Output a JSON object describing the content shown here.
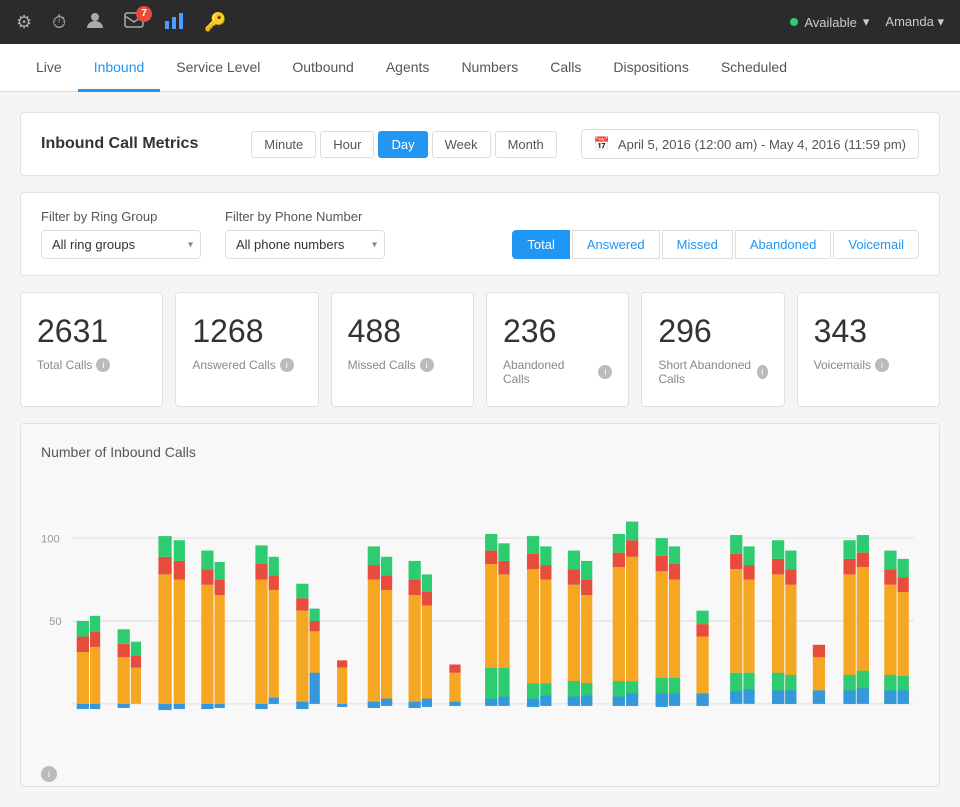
{
  "topNav": {
    "icons": [
      {
        "name": "recycle-icon",
        "symbol": "♻",
        "active": false
      },
      {
        "name": "clock-icon",
        "symbol": "⏱",
        "active": false
      },
      {
        "name": "person-icon",
        "symbol": "👤",
        "active": false
      },
      {
        "name": "mail-icon",
        "symbol": "✉",
        "active": false,
        "badge": "7"
      },
      {
        "name": "chart-icon",
        "symbol": "📊",
        "active": true
      },
      {
        "name": "key-icon",
        "symbol": "🔑",
        "active": false
      }
    ],
    "status": "Available",
    "user": "Amanda"
  },
  "tabs": [
    {
      "label": "Live",
      "active": false
    },
    {
      "label": "Inbound",
      "active": true
    },
    {
      "label": "Service Level",
      "active": false
    },
    {
      "label": "Outbound",
      "active": false
    },
    {
      "label": "Agents",
      "active": false
    },
    {
      "label": "Numbers",
      "active": false
    },
    {
      "label": "Calls",
      "active": false
    },
    {
      "label": "Dispositions",
      "active": false
    },
    {
      "label": "Scheduled",
      "active": false
    }
  ],
  "metrics": {
    "title": "Inbound Call Metrics",
    "timeButtons": [
      {
        "label": "Minute",
        "active": false
      },
      {
        "label": "Hour",
        "active": false
      },
      {
        "label": "Day",
        "active": true
      },
      {
        "label": "Week",
        "active": false
      },
      {
        "label": "Month",
        "active": false
      }
    ],
    "dateRange": "April 5, 2016 (12:00 am) - May 4, 2016 (11:59 pm)"
  },
  "filters": {
    "ringGroupLabel": "Filter by Ring Group",
    "ringGroupValue": "All ring groups",
    "phoneNumberLabel": "Filter by Phone Number",
    "phoneNumberValue": "All phone numbers"
  },
  "viewToggle": {
    "buttons": [
      {
        "label": "Total",
        "active": true
      },
      {
        "label": "Answered",
        "active": false
      },
      {
        "label": "Missed",
        "active": false
      },
      {
        "label": "Abandoned",
        "active": false
      },
      {
        "label": "Voicemail",
        "active": false
      }
    ]
  },
  "stats": [
    {
      "number": "2631",
      "label": "Total Calls"
    },
    {
      "number": "1268",
      "label": "Answered Calls"
    },
    {
      "number": "488",
      "label": "Missed Calls"
    },
    {
      "number": "236",
      "label": "Abandoned Calls"
    },
    {
      "number": "296",
      "label": "Short Abandoned Calls"
    },
    {
      "number": "343",
      "label": "Voicemails"
    }
  ],
  "chart": {
    "title": "Number of Inbound Calls",
    "yLabels": [
      "100",
      "50"
    ],
    "colors": {
      "answered": "#f5a623",
      "missed": "#e74c3c",
      "abandoned": "#2ecc71",
      "voicemail": "#3498db",
      "shortAbandoned": "#27ae60"
    }
  }
}
